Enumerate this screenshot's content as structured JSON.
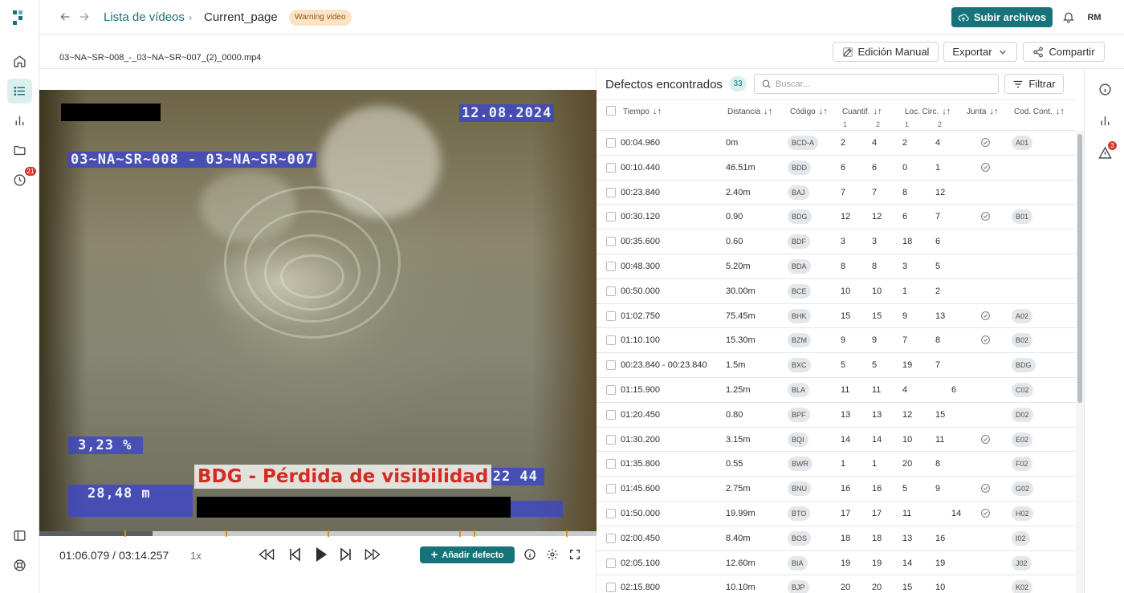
{
  "app": {
    "rail_badge": "21",
    "right_rail_badge": "3",
    "accent": "#17737a"
  },
  "header": {
    "breadcrumb_link": "Lista de vídeos",
    "breadcrumb_current": "Current_page",
    "status_pill": "Warning video",
    "upload_label": "Subir archivos",
    "avatar_initials": "RM"
  },
  "file": {
    "name": "03~NA~SR~008_-_03~NA~SR~007_(2)_0000.mp4",
    "manual_edit_label": "Edición Manual",
    "export_label": "Exportar",
    "share_label": "Compartir"
  },
  "video": {
    "overlay_date": "12.08.2024",
    "overlay_section": "03~NA~SR~008 - 03~NA~SR~007",
    "overlay_percent": "3,23 %",
    "overlay_distance": "28,48 m",
    "overlay_clock": "14 22 44",
    "defect_label": "BDG - Pérdida de visibilidad",
    "progress_fraction": 0.203,
    "defect_marker_fractions": [
      0.153,
      0.335,
      0.518,
      0.754,
      0.78,
      0.945
    ]
  },
  "player": {
    "timecode": "01:06.079 / 03:14.257",
    "speed": "1x",
    "add_defect_label": "Añadir defecto"
  },
  "defects": {
    "title": "Defectos encontrados",
    "count": "33",
    "search_placeholder": "Buscar...",
    "filter_label": "Filtrar",
    "columns": {
      "time": "Tiempo",
      "distance": "Distancia",
      "code": "Código",
      "quant": "Cuantif.",
      "quant_1": "1",
      "quant_2": "2",
      "loc": "Loc. Circ.",
      "loc_1": "1",
      "loc_2": "2",
      "joint": "Junta",
      "cont": "Cod. Cont."
    },
    "rows": [
      {
        "time": "00:04.960",
        "distance": "0m",
        "code": "BCD-A",
        "q1": "2",
        "q2": "4",
        "l1": "2",
        "l2": "4",
        "joint": true,
        "cont": "A01"
      },
      {
        "time": "00:10.440",
        "distance": "46.51m",
        "code": "BDD",
        "q1": "6",
        "q2": "6",
        "l1": "0",
        "l2": "1",
        "joint": true,
        "cont": ""
      },
      {
        "time": "00:23.840",
        "distance": "2.40m",
        "code": "BAJ",
        "q1": "7",
        "q2": "7",
        "l1": "8",
        "l2": "12",
        "joint": false,
        "cont": ""
      },
      {
        "time": "00:30.120",
        "distance": "0.90",
        "code": "BDG",
        "q1": "12",
        "q2": "12",
        "l1": "6",
        "l2": "7",
        "joint": true,
        "cont": "B01"
      },
      {
        "time": "00:35.600",
        "distance": "0.60",
        "code": "BDF",
        "q1": "3",
        "q2": "3",
        "l1": "18",
        "l2": "6",
        "joint": false,
        "cont": ""
      },
      {
        "time": "00:48.300",
        "distance": "5.20m",
        "code": "BDA",
        "q1": "8",
        "q2": "8",
        "l1": "3",
        "l2": "5",
        "joint": false,
        "cont": ""
      },
      {
        "time": "00:50.000",
        "distance": "30.00m",
        "code": "BCE",
        "q1": "10",
        "q2": "10",
        "l1": "1",
        "l2": "2",
        "joint": false,
        "cont": ""
      },
      {
        "time": "01:02.750",
        "distance": "75.45m",
        "code": "BHK",
        "q1": "15",
        "q2": "15",
        "l1": "9",
        "l2": "13",
        "joint": true,
        "cont": "A02"
      },
      {
        "time": "01:10.100",
        "distance": "15.30m",
        "code": "BZM",
        "q1": "9",
        "q2": "9",
        "l1": "7",
        "l2": "8",
        "joint": true,
        "cont": "B02"
      },
      {
        "time": "00:23.840 - 00:23.840",
        "distance": "1.5m",
        "code": "BXC",
        "q1": "5",
        "q2": "5",
        "l1": "19",
        "l2": "7",
        "joint": false,
        "cont": "BDG"
      },
      {
        "time": "01:15.900",
        "distance": "1.25m",
        "code": "BLA",
        "q1": "11",
        "q2": "11",
        "l1": "4",
        "l2": "6",
        "l2_offset": true,
        "joint": false,
        "cont": "C02"
      },
      {
        "time": "01:20.450",
        "distance": "0.80",
        "code": "BPF",
        "q1": "13",
        "q2": "13",
        "l1": "12",
        "l2": "15",
        "joint": false,
        "cont": "D02"
      },
      {
        "time": "01:30.200",
        "distance": "3.15m",
        "code": "BQI",
        "q1": "14",
        "q2": "14",
        "l1": "10",
        "l2": "11",
        "joint": true,
        "cont": "E02"
      },
      {
        "time": "01:35.800",
        "distance": "0.55",
        "code": "BWR",
        "q1": "1",
        "q2": "1",
        "l1": "20",
        "l2": "8",
        "joint": false,
        "cont": "F02"
      },
      {
        "time": "01:45.600",
        "distance": "2.75m",
        "code": "BNU",
        "q1": "16",
        "q2": "16",
        "l1": "5",
        "l2": "9",
        "joint": true,
        "cont": "G02"
      },
      {
        "time": "01:50.000",
        "distance": "19.99m",
        "code": "BTO",
        "q1": "17",
        "q2": "17",
        "l1": "11",
        "l2": "14",
        "l2_offset": true,
        "joint": true,
        "cont": "H02"
      },
      {
        "time": "02:00.450",
        "distance": "8.40m",
        "code": "BOS",
        "q1": "18",
        "q2": "18",
        "l1": "13",
        "l2": "16",
        "joint": false,
        "cont": "I02"
      },
      {
        "time": "02:05.100",
        "distance": "12.60m",
        "code": "BIA",
        "q1": "19",
        "q2": "19",
        "l1": "14",
        "l2": "19",
        "joint": false,
        "cont": "J02"
      },
      {
        "time": "02:15.800",
        "distance": "10.10m",
        "code": "BJP",
        "q1": "20",
        "q2": "20",
        "l1": "15",
        "l2": "10",
        "joint": false,
        "cont": "K02"
      }
    ]
  }
}
